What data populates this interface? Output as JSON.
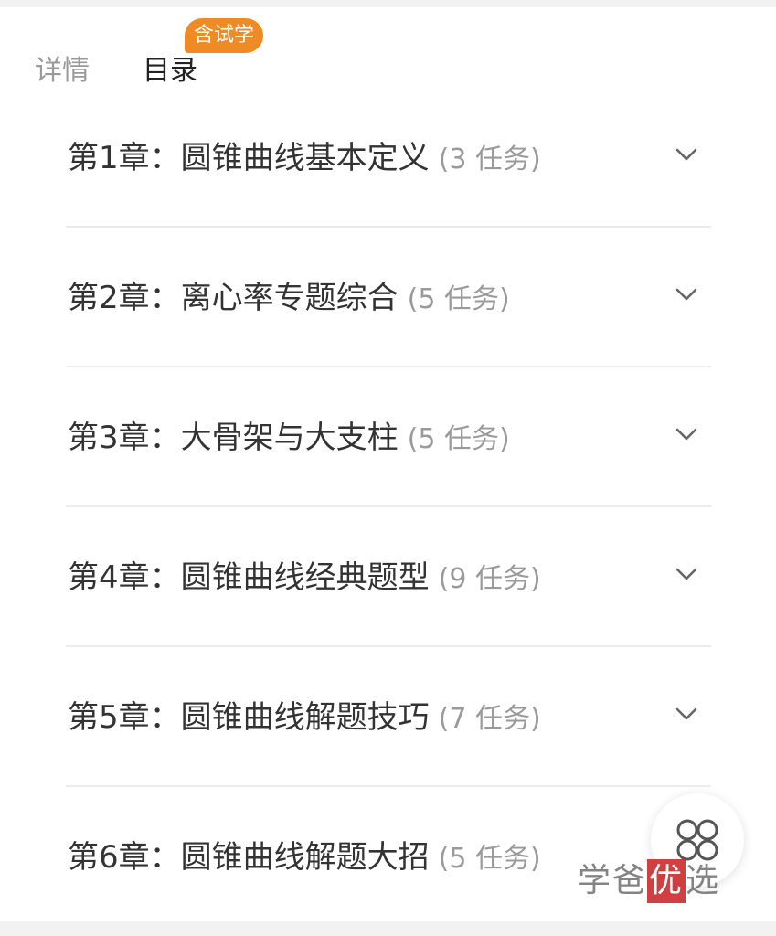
{
  "tabs": {
    "details_label": "详情",
    "catalog_label": "目录",
    "catalog_badge": "含试学"
  },
  "chapters": [
    {
      "title": "第1章：圆锥曲线基本定义",
      "count": "(3 任务)"
    },
    {
      "title": "第2章：离心率专题综合",
      "count": "(5 任务)"
    },
    {
      "title": "第3章：大骨架与大支柱",
      "count": "(5 任务)"
    },
    {
      "title": "第4章：圆锥曲线经典题型",
      "count": "(9 任务)"
    },
    {
      "title": "第5章：圆锥曲线解题技巧",
      "count": "(7 任务)"
    },
    {
      "title": "第6章：圆锥曲线解题大招",
      "count": "(5 任务)"
    }
  ],
  "icons": {
    "chevron": "chevron-down-icon",
    "fab": "grid-menu-icon"
  },
  "watermark": {
    "part1": "学爸",
    "seal": "优",
    "part2": "选"
  },
  "colors": {
    "accent": "#f08a24",
    "text_primary": "#333333",
    "text_secondary": "#9a9a9a",
    "divider": "#ececec"
  }
}
